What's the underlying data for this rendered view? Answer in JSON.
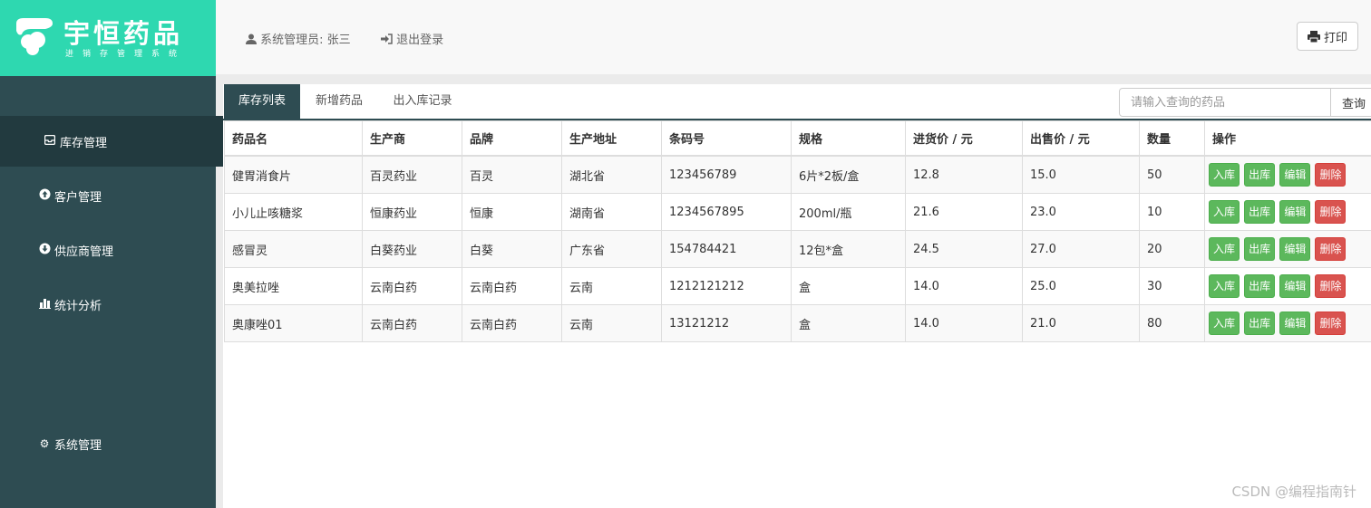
{
  "brand": {
    "title": "宇恒药品",
    "subtitle": "进销存管理系统",
    "color": "#2ed8b0"
  },
  "sidebar": {
    "background": "#2e4c52",
    "items": [
      {
        "label": "库存管理",
        "icon": "inbox-icon",
        "active": true
      },
      {
        "label": "客户管理",
        "icon": "circle-arrow-up-icon"
      },
      {
        "label": "供应商管理",
        "icon": "circle-arrow-down-icon"
      },
      {
        "label": "统计分析",
        "icon": "bar-chart-icon"
      },
      {
        "label": "系统管理",
        "icon": "gear-icon"
      }
    ]
  },
  "header": {
    "user": "系统管理员: 张三",
    "logout": "退出登录",
    "print": "打印"
  },
  "tabs": [
    {
      "label": "库存列表",
      "active": true
    },
    {
      "label": "新增药品"
    },
    {
      "label": "出入库记录"
    }
  ],
  "search": {
    "placeholder": "请输入查询的药品",
    "button": "查询"
  },
  "table": {
    "headers": [
      "药品名",
      "生产商",
      "品牌",
      "生产地址",
      "条码号",
      "规格",
      "进货价 / 元",
      "出售价 / 元",
      "数量",
      "操作"
    ],
    "rows": [
      [
        "健胃消食片",
        "百灵药业",
        "百灵",
        "湖北省",
        "123456789",
        "6片*2板/盒",
        "12.8",
        "15.0",
        "50"
      ],
      [
        "小儿止咳糖浆",
        "恒康药业",
        "恒康",
        "湖南省",
        "1234567895",
        "200ml/瓶",
        "21.6",
        "23.0",
        "10"
      ],
      [
        "感冒灵",
        "白葵药业",
        "白葵",
        "广东省",
        "154784421",
        "12包*盒",
        "24.5",
        "27.0",
        "20"
      ],
      [
        "奥美拉唑",
        "云南白药",
        "云南白药",
        "云南",
        "1212121212",
        "盒",
        "14.0",
        "25.0",
        "30"
      ],
      [
        "奥康唑01",
        "云南白药",
        "云南白药",
        "云南",
        "13121212",
        "盒",
        "14.0",
        "21.0",
        "80"
      ]
    ],
    "actions": {
      "stock_in": "入库",
      "stock_out": "出库",
      "edit": "编辑",
      "delete": "删除"
    }
  },
  "watermark": "CSDN @编程指南针"
}
